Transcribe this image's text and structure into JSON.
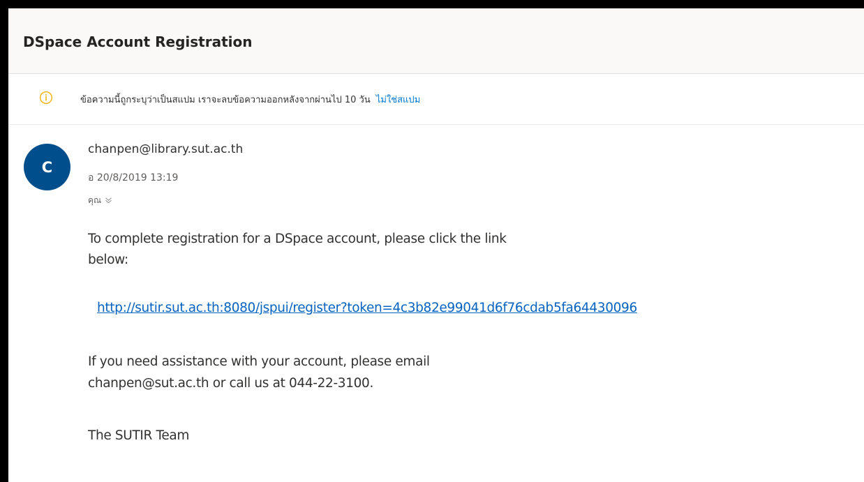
{
  "message": {
    "subject": "DSpace Account Registration",
    "spam_notice": {
      "text": "ข้อความนี้ถูกระบุว่าเป็นสแปม เราจะลบข้อความออกหลังจากผ่านไป 10 วัน",
      "action_link": "ไม่ใช่สแปม",
      "icon": "info-circle-icon"
    },
    "sender": {
      "avatar_letter": "C",
      "email": "chanpen@library.sut.ac.th",
      "date": "อ 20/8/2019 13:19",
      "recipient": "คุณ"
    },
    "body": {
      "line1": "To complete registration for a DSpace account, please click the link",
      "line1b": "below:",
      "link": "http://sutir.sut.ac.th:8080/jspui/register?token=4c3b82e99041d6f76cdab5fa64430096",
      "line3": "If you need assistance with your account, please email",
      "line3b": "chanpen@sut.ac.th or call us at 044-22-3100.",
      "signature": "The SUTIR Team"
    }
  },
  "colors": {
    "frame": "#000000",
    "avatar": "#004e8c",
    "link": "#0563c1",
    "spam_link": "#0078d4",
    "info_icon": "#f2b200"
  }
}
